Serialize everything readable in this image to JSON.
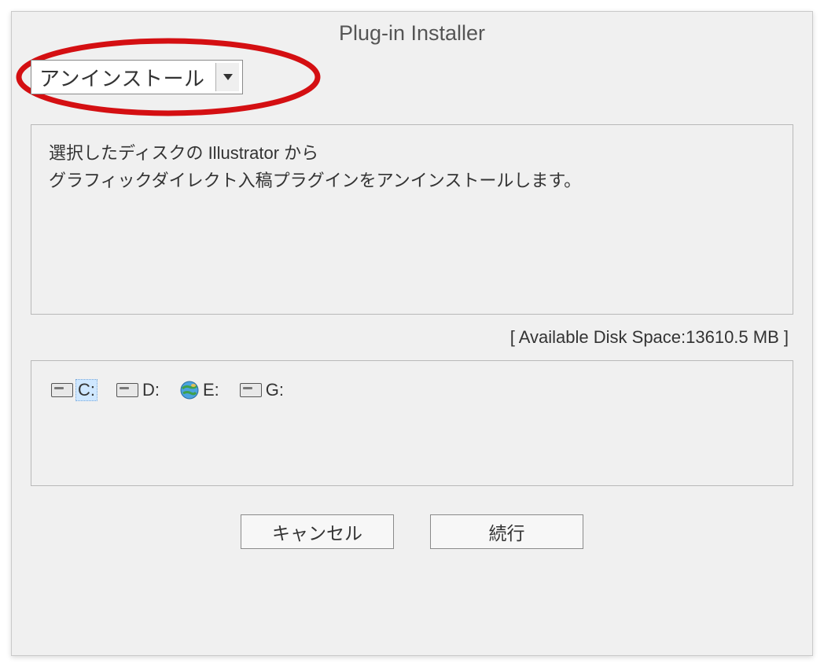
{
  "window": {
    "title": "Plug-in Installer"
  },
  "dropdown": {
    "selected": "アンインストール"
  },
  "description": {
    "line1": "選択したディスクの Illustrator から",
    "line2": "グラフィックダイレクト入稿プラグインをアンインストールします。"
  },
  "disk_space": {
    "label": "[ Available Disk Space:13610.5 MB ]"
  },
  "disks": [
    {
      "label": "C:",
      "icon": "hdd",
      "selected": true
    },
    {
      "label": "D:",
      "icon": "hdd",
      "selected": false
    },
    {
      "label": "E:",
      "icon": "globe",
      "selected": false
    },
    {
      "label": "G:",
      "icon": "hdd",
      "selected": false
    }
  ],
  "buttons": {
    "cancel": "キャンセル",
    "continue": "続行"
  },
  "annotation": {
    "ellipse_color": "#d40f12"
  }
}
